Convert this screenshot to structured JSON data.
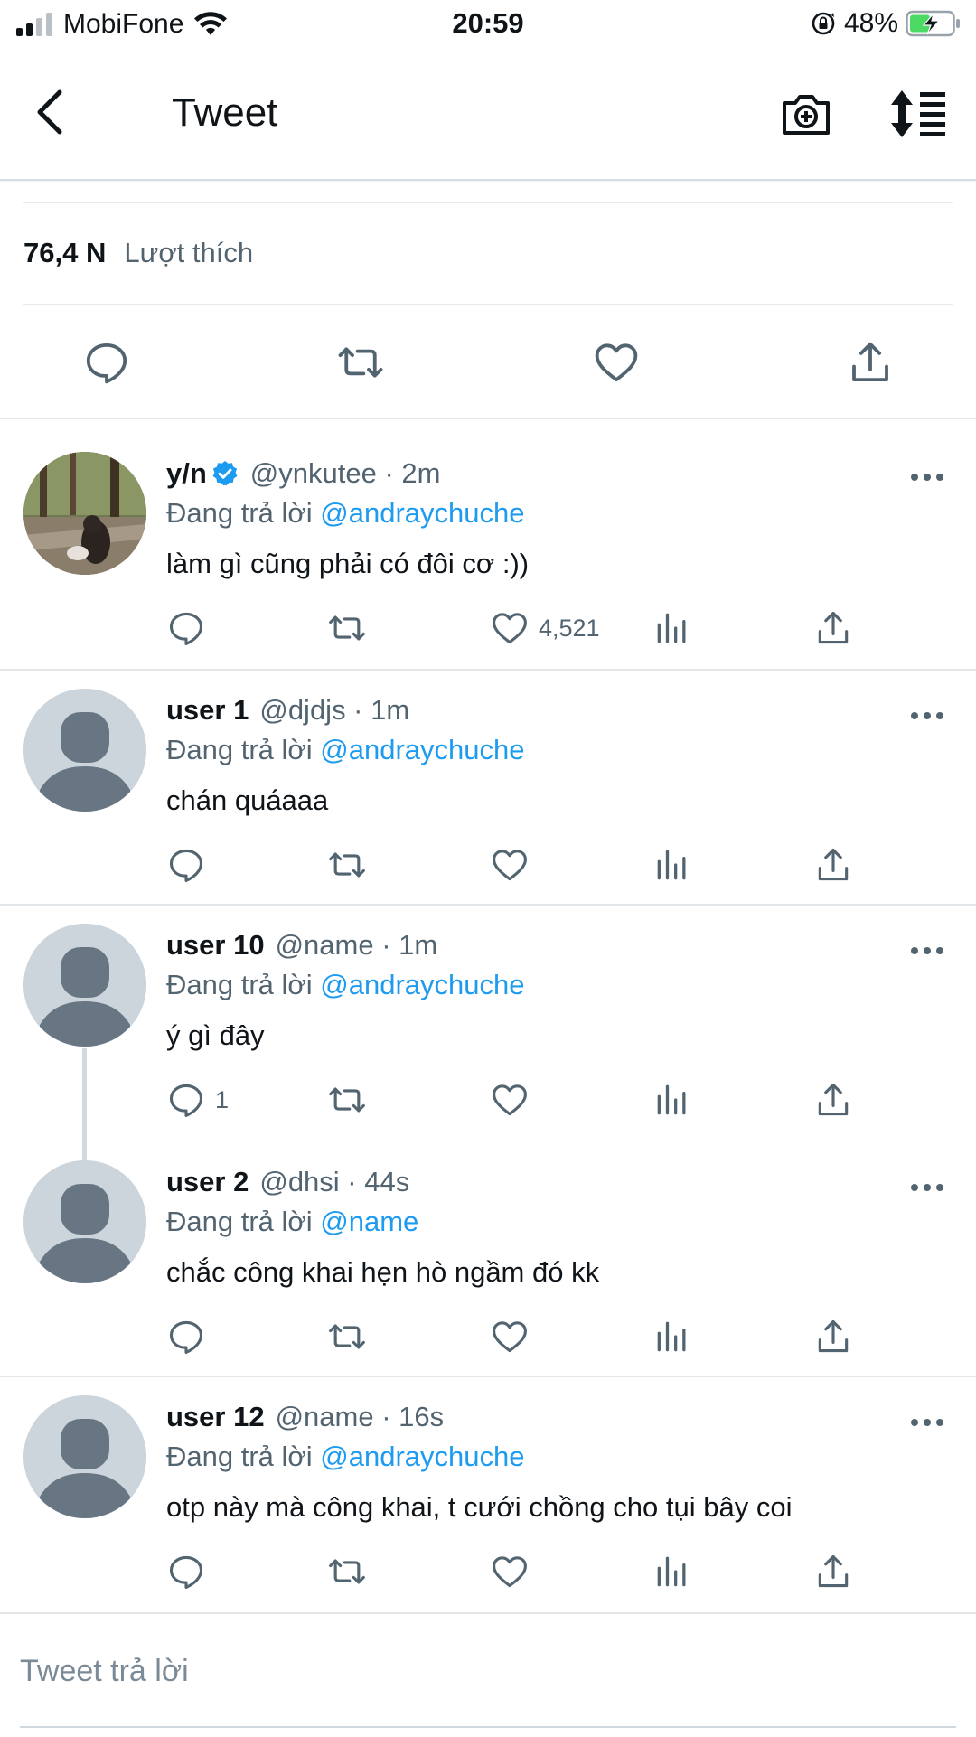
{
  "status_bar": {
    "carrier": "MobiFone",
    "time": "20:59",
    "battery": "48%"
  },
  "nav": {
    "title": "Tweet",
    "icons": [
      "back-chevron-icon",
      "camera-plus-icon",
      "sort-lines-icon"
    ]
  },
  "stats": {
    "likes_count": "76,4 N",
    "likes_label": "Lượt thích"
  },
  "main_actions": [
    "reply-icon",
    "retweet-icon",
    "like-icon",
    "share-icon"
  ],
  "reply_prefix": "Đang trả lời",
  "tweets": [
    {
      "name": "y/n",
      "verified": true,
      "handle": "@ynkutee · 2m",
      "reply_to": "@andraychuche",
      "text": "làm gì cũng phải có đôi cơ :))",
      "reply_count": "",
      "like_count": "4,521",
      "avatar": "photo"
    },
    {
      "name": "user 1",
      "verified": false,
      "handle": "@djdjs · 1m",
      "reply_to": "@andraychuche",
      "text": "chán quáaaa",
      "reply_count": "",
      "like_count": "",
      "avatar": "default"
    },
    {
      "name": "user 10",
      "verified": false,
      "handle": "@name · 1m",
      "reply_to": "@andraychuche",
      "text": "ý gì đây",
      "reply_count": "1",
      "like_count": "",
      "avatar": "default"
    },
    {
      "name": "user 2",
      "verified": false,
      "handle": "@dhsi · 44s",
      "reply_to": "@name",
      "text": "chắc công khai hẹn hò ngầm đó kk",
      "reply_count": "",
      "like_count": "",
      "avatar": "default"
    },
    {
      "name": "user 12",
      "verified": false,
      "handle": "@name · 16s",
      "reply_to": "@andraychuche",
      "text": "otp này mà công khai, t cưới chồng cho tụi bây coi",
      "reply_count": "",
      "like_count": "",
      "avatar": "default"
    }
  ],
  "reply_bar": {
    "placeholder": "Tweet trả lời"
  },
  "colors": {
    "accent": "#1d9bf0",
    "text": "#0f1419",
    "secondary": "#536471",
    "icon": "#536471",
    "avatar_bg": "#cdd5dc",
    "avatar_fg": "#687684",
    "divider": "#e3e7ea"
  }
}
